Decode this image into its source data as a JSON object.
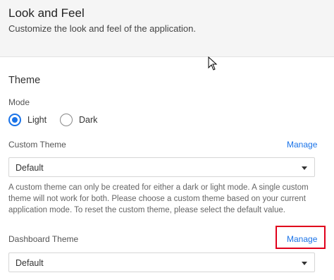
{
  "header": {
    "title": "Look and Feel",
    "subtitle": "Customize the look and feel of the application."
  },
  "theme": {
    "section_title": "Theme",
    "mode": {
      "label": "Mode",
      "options": [
        "Light",
        "Dark"
      ],
      "selected": "Light"
    },
    "custom_theme": {
      "label": "Custom Theme",
      "manage_label": "Manage",
      "value": "Default",
      "help_text": "A custom theme can only be created for either a dark or light mode. A single custom theme will not work for both. Please choose a custom theme based on your current application mode. To reset the custom theme, please select the default value."
    },
    "dashboard_theme": {
      "label": "Dashboard Theme",
      "manage_label": "Manage",
      "value": "Default"
    }
  },
  "colors": {
    "accent": "#1a73e8",
    "highlight": "#e0001b",
    "header_bg": "#f5f5f5"
  },
  "icons": {
    "cursor": "mouse-pointer-icon",
    "dropdown": "chevron-down-icon"
  }
}
